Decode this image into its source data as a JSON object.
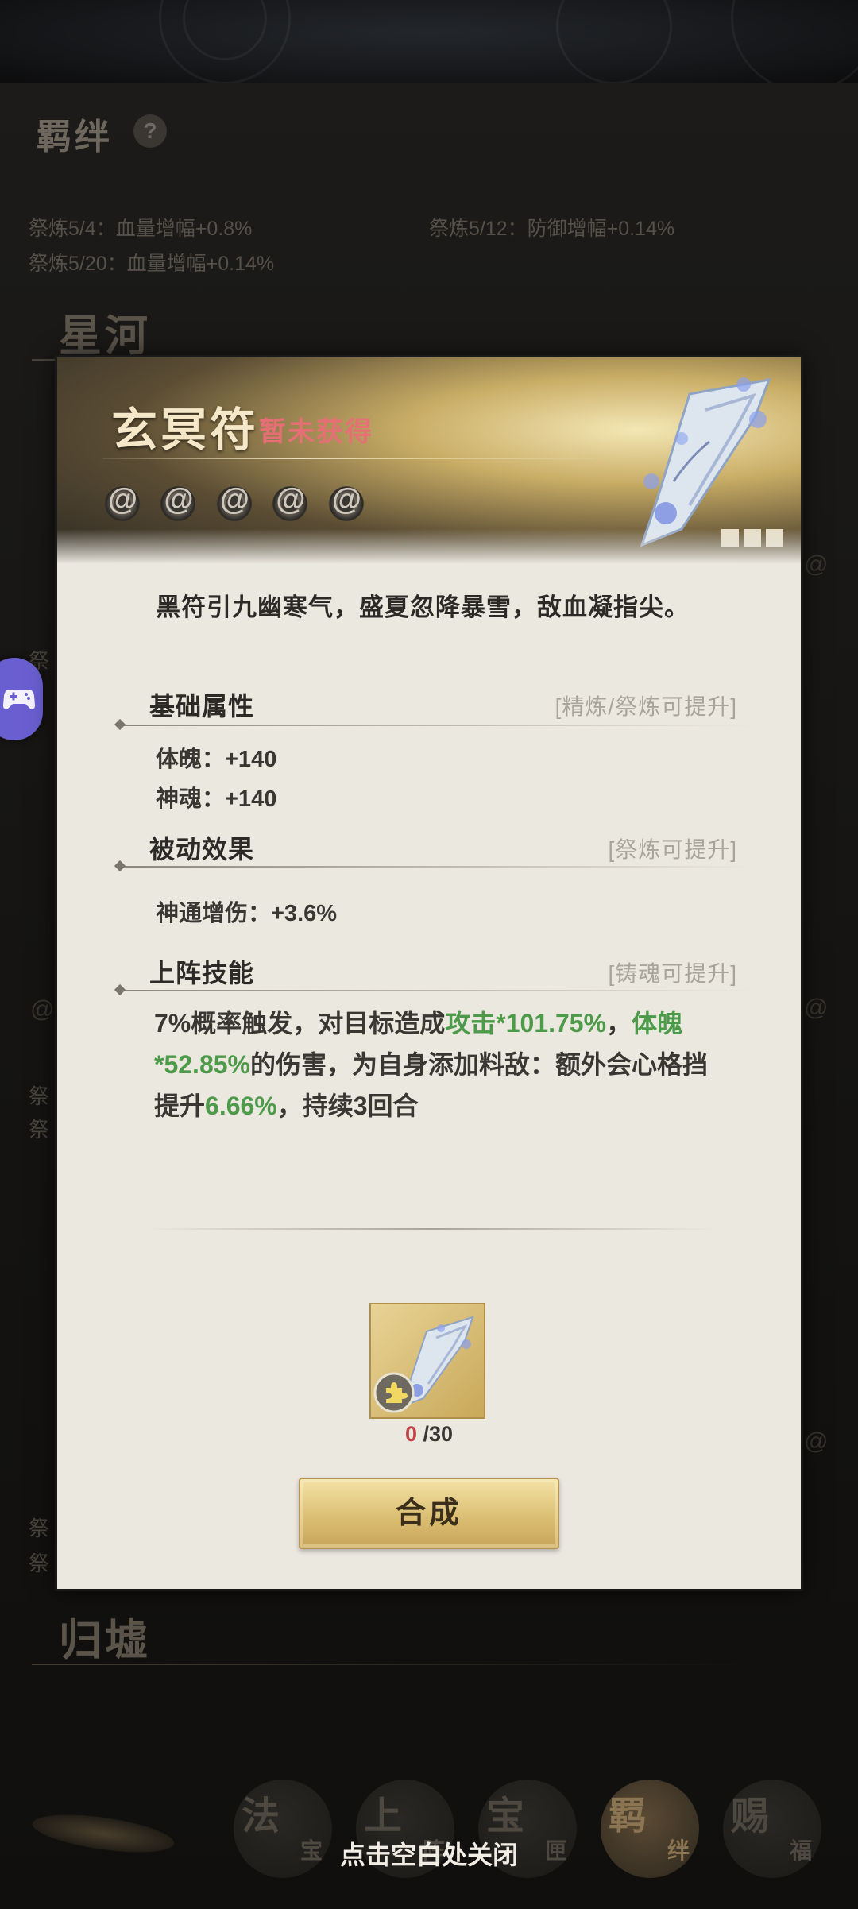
{
  "background": {
    "title": "羁绊",
    "help_glyph": "?",
    "bonus_lines": [
      "祭炼5/4：血量增幅+0.8%",
      "祭炼5/12：防御增幅+0.14%",
      "祭炼5/20：血量增幅+0.14%"
    ],
    "sections": [
      "星河",
      "归墟"
    ],
    "left_fragments": [
      "祭",
      "祭",
      "祭",
      "祭",
      "祭"
    ]
  },
  "bottom_nav": [
    {
      "big": "法",
      "small": "宝"
    },
    {
      "big": "上",
      "small": "阵"
    },
    {
      "big": "宝",
      "small": "匣"
    },
    {
      "big": "羁",
      "small": "绊"
    },
    {
      "big": "赐",
      "small": "福"
    }
  ],
  "close_hint": "点击空白处关闭",
  "modal": {
    "name": "玄冥符",
    "status": "暂未获得",
    "stars_total": 5,
    "description": "黑符引九幽寒气，盛夏忽降暴雪，敌血凝指尖。",
    "basic_attributes": {
      "title": "基础属性",
      "hint": "[精炼/祭炼可提升]",
      "items": [
        "体魄：+140",
        "神魂：+140"
      ]
    },
    "passive_effects": {
      "title": "被动效果",
      "hint": "[祭炼可提升]",
      "items": [
        "神通增伤：+3.6%"
      ]
    },
    "battle_skill": {
      "title": "上阵技能",
      "hint": "[铸魂可提升]",
      "text_parts": [
        {
          "text": "7%概率触发，对目标造成",
          "highlight": false
        },
        {
          "text": "攻击*101.75%",
          "highlight": true
        },
        {
          "text": "，",
          "highlight": false
        },
        {
          "text": "体魄*52.85%",
          "highlight": true
        },
        {
          "text": "的伤害，为自身添加料敌：额外会心格挡提升",
          "highlight": false
        },
        {
          "text": "6.66%",
          "highlight": true
        },
        {
          "text": "，持续3回合",
          "highlight": false
        }
      ]
    },
    "fragment": {
      "owned": "0",
      "required": "/30",
      "icon": "puzzle-piece-icon"
    },
    "synthesize_label": "合成"
  },
  "colors": {
    "status_red": "#e66f75",
    "highlight_green": "#4c9a4a",
    "button_gold": "#dcbf74",
    "card_bg": "#ebe8e0"
  }
}
